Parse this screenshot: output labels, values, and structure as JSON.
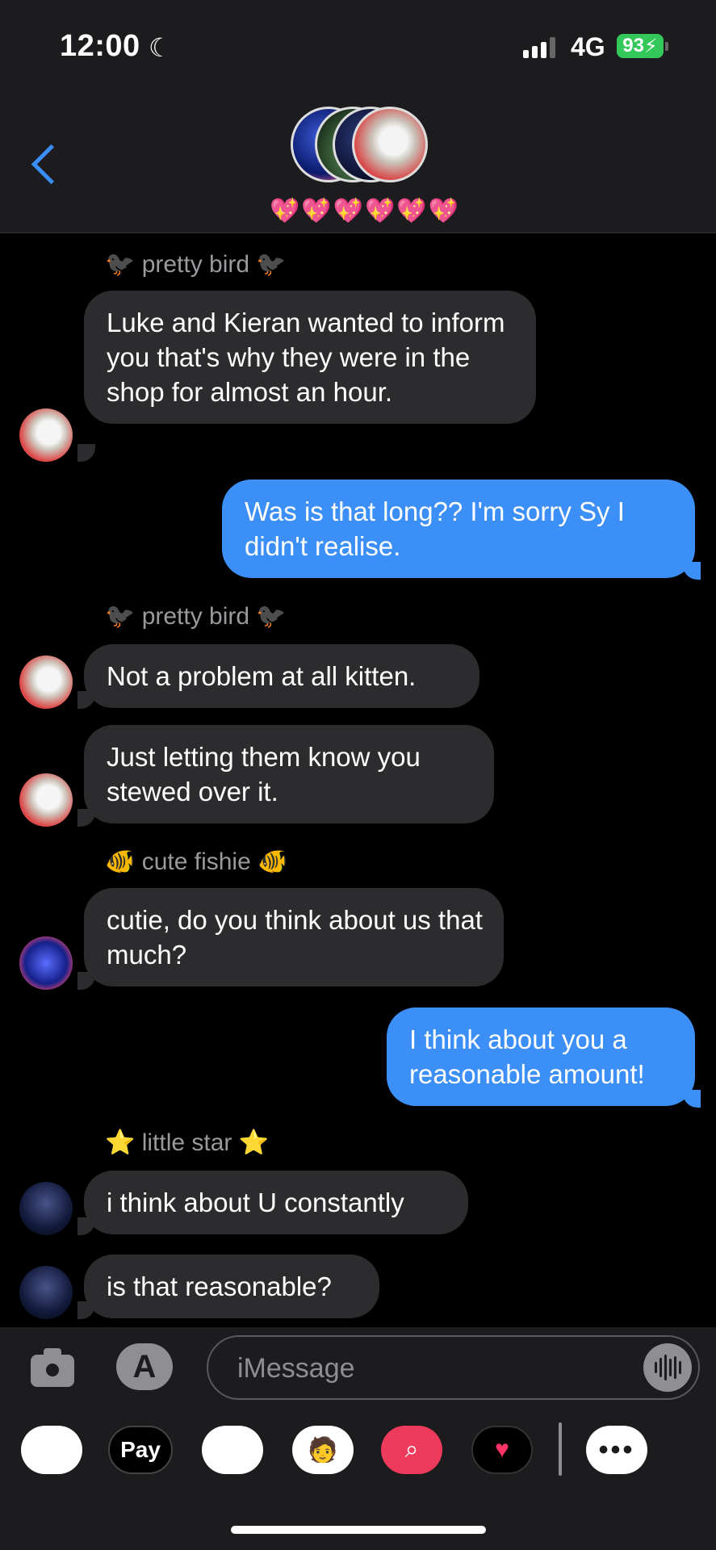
{
  "status_bar": {
    "time": "12:00",
    "focus_icon": "moon-icon",
    "network": "4G",
    "battery": "93"
  },
  "header": {
    "back_icon": "chevron-left-icon",
    "group_name": "💖💖💖💖💖💖"
  },
  "messages": [
    {
      "sender": "🐦‍⬛ pretty bird 🐦‍⬛",
      "text": "Luke and Kieran wanted to inform you that's why they were in the shop for almost an hour.",
      "direction": "incoming"
    },
    {
      "text": "Was is that long?? I'm sorry Sy I didn't realise.",
      "direction": "outgoing"
    },
    {
      "sender": "🐦‍⬛ pretty bird 🐦‍⬛",
      "text": "Not a problem at all kitten.",
      "direction": "incoming"
    },
    {
      "text": "Just letting them know you stewed over it.",
      "direction": "incoming"
    },
    {
      "sender": "🐠 cute fishie 🐠",
      "text": "cutie, do you think about us that much?",
      "direction": "incoming"
    },
    {
      "text": "I think about you a reasonable amount!",
      "direction": "outgoing"
    },
    {
      "sender": "⭐ little star ⭐",
      "text": "i think about U constantly",
      "direction": "incoming"
    },
    {
      "text": "is that reasonable?",
      "direction": "incoming"
    }
  ],
  "compose": {
    "placeholder": "iMessage",
    "camera_icon": "camera-icon",
    "apps_icon": "app-store-icon",
    "audio_icon": "audio-waveform-icon"
  },
  "app_drawer": {
    "apple_pay_label": "Pay",
    "items": [
      "photos-icon",
      "apple-pay-icon",
      "animoji-icon",
      "memoji-icon",
      "image-search-icon",
      "digital-touch-icon",
      "more-icon"
    ]
  },
  "colors": {
    "outgoing_bubble": "#3b8ff6",
    "incoming_bubble": "#2c2c2e",
    "accent": "#3a8ef6",
    "battery": "#34c759"
  }
}
